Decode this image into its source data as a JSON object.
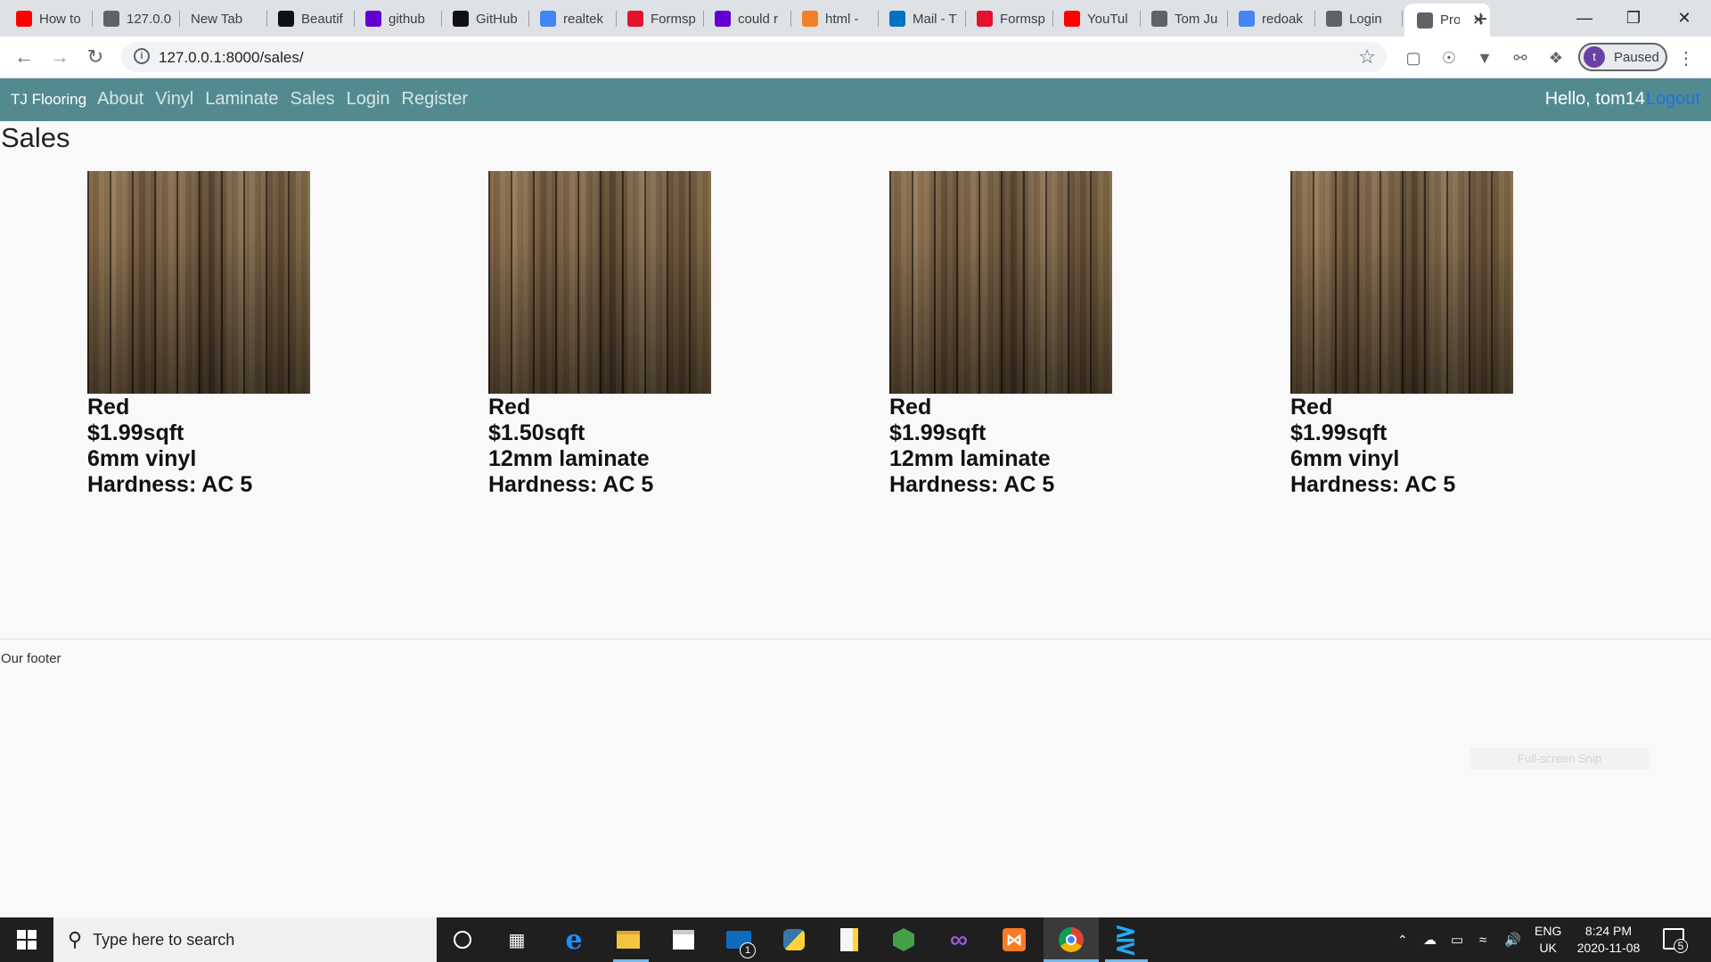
{
  "browser": {
    "tabs": [
      {
        "title": "How to",
        "favicon": "youtube-icon",
        "color": "#ff0000"
      },
      {
        "title": "127.0.0",
        "favicon": "globe-icon",
        "color": "#5f6368"
      },
      {
        "title": "New Tab",
        "favicon": "none",
        "color": "#5f6368"
      },
      {
        "title": "Beautif",
        "favicon": "beautiful-soup-icon",
        "color": "#111111"
      },
      {
        "title": "github",
        "favicon": "yahoo-icon",
        "color": "#6001d2"
      },
      {
        "title": "GitHub",
        "favicon": "github-icon",
        "color": "#111111"
      },
      {
        "title": "realtek",
        "favicon": "google-icon",
        "color": "#4285f4"
      },
      {
        "title": "Formsp",
        "favicon": "formspree-icon",
        "color": "#e5122e"
      },
      {
        "title": "could r",
        "favicon": "yahoo-icon",
        "color": "#6001d2"
      },
      {
        "title": "html -",
        "favicon": "stackoverflow-icon",
        "color": "#f48024"
      },
      {
        "title": "Mail - T",
        "favicon": "outlook-icon",
        "color": "#0072c6"
      },
      {
        "title": "Formsp",
        "favicon": "formspree-icon",
        "color": "#e5122e"
      },
      {
        "title": "YouTul",
        "favicon": "youtube-icon",
        "color": "#ff0000"
      },
      {
        "title": "Tom Ju",
        "favicon": "globe-icon",
        "color": "#5f6368"
      },
      {
        "title": "redoak",
        "favicon": "google-icon",
        "color": "#4285f4"
      },
      {
        "title": "Login",
        "favicon": "globe-icon",
        "color": "#5f6368"
      }
    ],
    "active_tab": {
      "title": "Pro",
      "favicon": "globe-icon"
    },
    "url": "127.0.0.1:8000/sales/",
    "profile": {
      "initial": "t",
      "status": "Paused"
    }
  },
  "site": {
    "brand": "TJ Flooring",
    "nav": [
      "About",
      "Vinyl",
      "Laminate",
      "Sales",
      "Login",
      "Register"
    ],
    "greeting": "Hello, tom14",
    "logout": "Logout",
    "accent": "#538a8f"
  },
  "page": {
    "title": "Sales",
    "products": [
      {
        "color": "Red",
        "price": "$1.99sqft",
        "type": "6mm vinyl",
        "hardness": "Hardness: AC 5"
      },
      {
        "color": "Red",
        "price": "$1.50sqft",
        "type": "12mm laminate",
        "hardness": "Hardness: AC 5"
      },
      {
        "color": "Red",
        "price": "$1.99sqft",
        "type": "12mm laminate",
        "hardness": "Hardness: AC 5"
      },
      {
        "color": "Red",
        "price": "$1.99sqft",
        "type": "6mm vinyl",
        "hardness": "Hardness: AC 5"
      }
    ],
    "footer": "Our footer",
    "snip_label": "Full-screen Snip"
  },
  "taskbar": {
    "search_placeholder": "Type here to search",
    "apps": [
      "cortana-icon",
      "task-view-icon",
      "edge-icon",
      "file-explorer-icon",
      "store-icon",
      "mail-icon",
      "python-icon",
      "notepad-icon",
      "node-icon",
      "visual-studio-icon",
      "xampp-icon",
      "chrome-icon",
      "vscode-icon"
    ],
    "mail_badge": "1",
    "language": {
      "line1": "ENG",
      "line2": "UK"
    },
    "time": "8:24 PM",
    "date": "2020-11-08",
    "notifications": "5"
  }
}
